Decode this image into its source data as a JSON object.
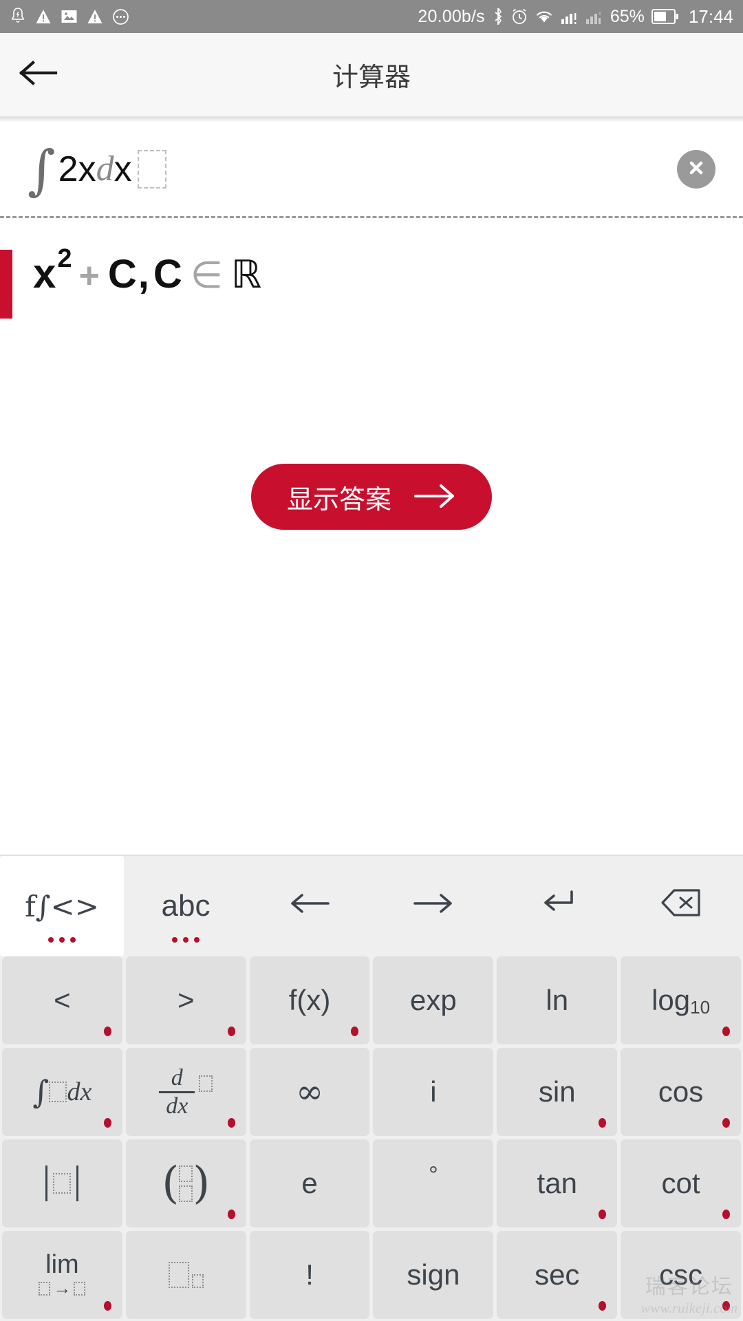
{
  "statusbar": {
    "left_icons": [
      "alarm-bell-icon",
      "warning-triangle-icon",
      "image-icon",
      "warning-triangle-icon",
      "more-circle-icon"
    ],
    "network_speed": "20.00b/s",
    "bluetooth_icon": "bluetooth-icon",
    "alarm_icon": "alarm-clock-icon",
    "wifi_icon": "wifi-icon",
    "signal_icon": "signal-bars-icon",
    "signal2_icon": "signal-bars-secondary-icon",
    "battery_percent": "65%",
    "battery_icon": "battery-icon",
    "time": "17:44"
  },
  "appbar": {
    "back_icon": "back-arrow-icon",
    "title": "计算器"
  },
  "input": {
    "integral_sign": "∫",
    "coefficient": "2",
    "variable": "x",
    "d": "d",
    "dx_var": "x",
    "placeholder_box": "empty-slot",
    "clear_icon": "clear-circle-icon"
  },
  "answer": {
    "base": "x",
    "exponent": "2",
    "plus": "+",
    "constant": "C",
    "comma": ",",
    "constant2": "C",
    "element_of": "∈",
    "reals": "ℝ",
    "accent_color": "#c8102e"
  },
  "cta": {
    "label": "显示答案",
    "arrow_icon": "right-arrow-icon"
  },
  "keyboard": {
    "toolbar": [
      {
        "id": "math-tab",
        "label": "f∫<>",
        "active": true,
        "dots": true
      },
      {
        "id": "abc-tab",
        "label": "abc",
        "active": false,
        "dots": true
      },
      {
        "id": "cursor-left",
        "label": "←",
        "active": false,
        "dots": false
      },
      {
        "id": "cursor-right",
        "label": "→",
        "active": false,
        "dots": false
      },
      {
        "id": "enter",
        "label": "↵",
        "active": false,
        "dots": false
      },
      {
        "id": "backspace",
        "label": "⌫",
        "active": false,
        "dots": false
      }
    ],
    "rows": [
      [
        {
          "id": "less-than",
          "label": "<",
          "dot": true
        },
        {
          "id": "greater-than",
          "label": ">",
          "dot": true
        },
        {
          "id": "function",
          "label": "f(x)",
          "dot": true
        },
        {
          "id": "exp",
          "label": "exp",
          "dot": false
        },
        {
          "id": "ln",
          "label": "ln",
          "dot": false
        },
        {
          "id": "log10",
          "label": "log",
          "sub": "10",
          "dot": true
        }
      ],
      [
        {
          "id": "integral",
          "label": "∫□dx",
          "dot": true
        },
        {
          "id": "derivative",
          "label": "d/dx □",
          "dot": true
        },
        {
          "id": "infinity",
          "label": "∞",
          "dot": false
        },
        {
          "id": "imaginary",
          "label": "i",
          "dot": false
        },
        {
          "id": "sin",
          "label": "sin",
          "dot": true
        },
        {
          "id": "cos",
          "label": "cos",
          "dot": true
        }
      ],
      [
        {
          "id": "absolute",
          "label": "|□|",
          "dot": false
        },
        {
          "id": "binomial",
          "label": "(□/□)",
          "dot": true
        },
        {
          "id": "euler-e",
          "label": "e",
          "dot": false
        },
        {
          "id": "degree",
          "label": "°",
          "dot": false
        },
        {
          "id": "tan",
          "label": "tan",
          "dot": true
        },
        {
          "id": "cot",
          "label": "cot",
          "dot": true
        }
      ],
      [
        {
          "id": "limit",
          "label": "lim □→□",
          "dot": true
        },
        {
          "id": "power",
          "label": "□^□",
          "dot": false
        },
        {
          "id": "factorial",
          "label": "!",
          "dot": false
        },
        {
          "id": "sign",
          "label": "sign",
          "dot": false
        },
        {
          "id": "sec",
          "label": "sec",
          "dot": true
        },
        {
          "id": "csc",
          "label": "csc",
          "dot": true
        }
      ]
    ]
  },
  "watermark": {
    "text_cn": "瑞客论坛",
    "url": "www.ruikeji.com"
  }
}
